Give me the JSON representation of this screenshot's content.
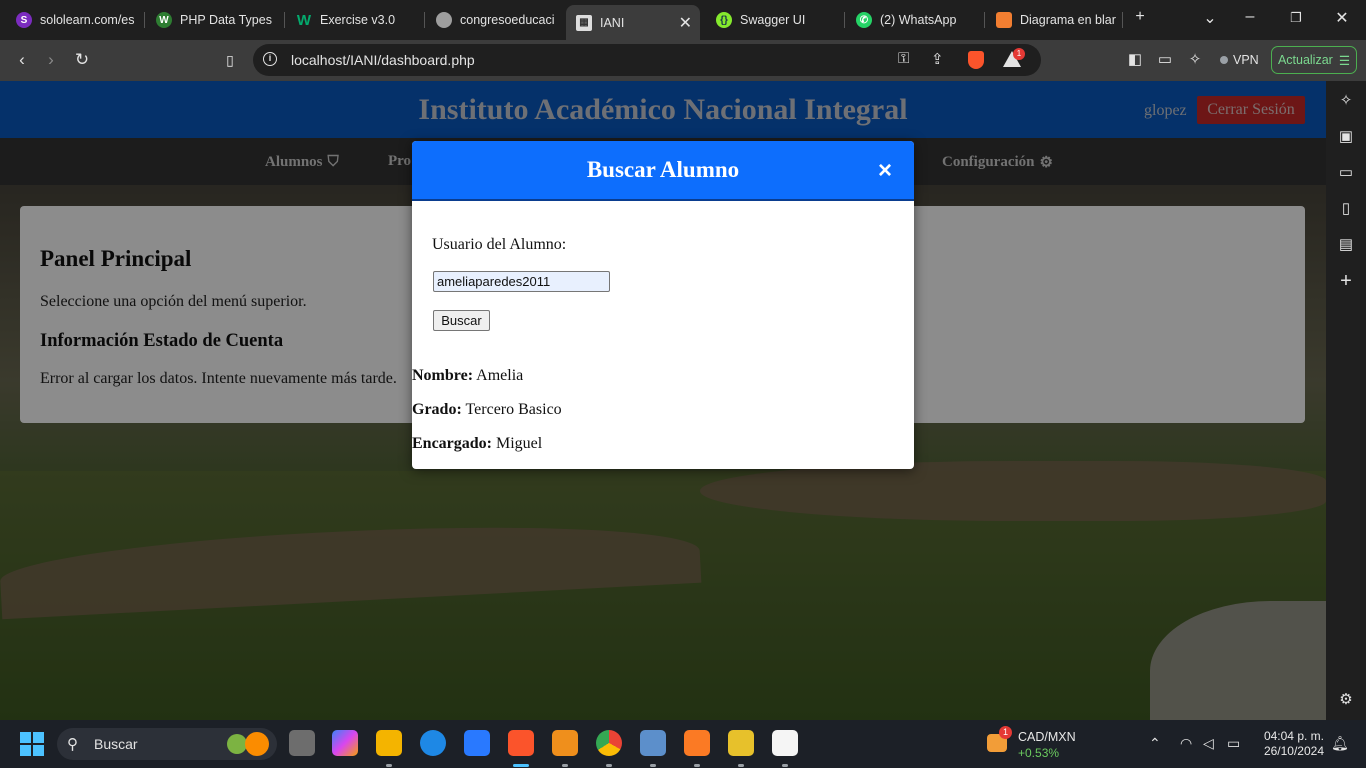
{
  "browser": {
    "tabs": [
      {
        "title": "sololearn.com/es",
        "color": "#ffffff"
      },
      {
        "title": "PHP Data Types",
        "color": "#04aa6d"
      },
      {
        "title": "Exercise v3.0",
        "color": "#04aa6d"
      },
      {
        "title": "congresoeducaci",
        "color": "#bdbdbd"
      },
      {
        "title": "IANI",
        "color": "#dddddd"
      },
      {
        "title": "Swagger UI",
        "color": "#85ea2d"
      },
      {
        "title": "(2) WhatsApp",
        "color": "#25d366"
      },
      {
        "title": "Diagrama en blar",
        "color": "#f27e31"
      }
    ],
    "url": "localhost/IANI/dashboard.php",
    "notification_count": "1",
    "vpn_label": "VPN",
    "update_label": "Actualizar"
  },
  "site": {
    "title": "Instituto Académico Nacional Integral",
    "user": "glopez",
    "logout": "Cerrar Sesión",
    "nav": [
      {
        "label": "Alumnos"
      },
      {
        "label": "Pro"
      },
      {
        "label": "Configuración"
      }
    ]
  },
  "panel": {
    "heading": "Panel Principal",
    "instruction": "Seleccione una opción del menú superior.",
    "subheading": "Información Estado de Cuenta",
    "error": "Error al cargar los datos. Intente nuevamente más tarde."
  },
  "modal": {
    "title": "Buscar Alumno",
    "close": "×",
    "field_label": "Usuario del Alumno:",
    "field_value": "ameliaparedes2011",
    "button": "Buscar",
    "results": [
      {
        "label": "Nombre:",
        "value": "Amelia"
      },
      {
        "label": "Grado:",
        "value": "Tercero Basico"
      },
      {
        "label": "Encargado:",
        "value": "Miguel"
      }
    ]
  },
  "taskbar": {
    "search": "Buscar",
    "widget_badge": "1",
    "widget_pair": "CAD/MXN",
    "widget_change": "+0.53%",
    "time": "04:04 p. m.",
    "date": "26/10/2024"
  }
}
